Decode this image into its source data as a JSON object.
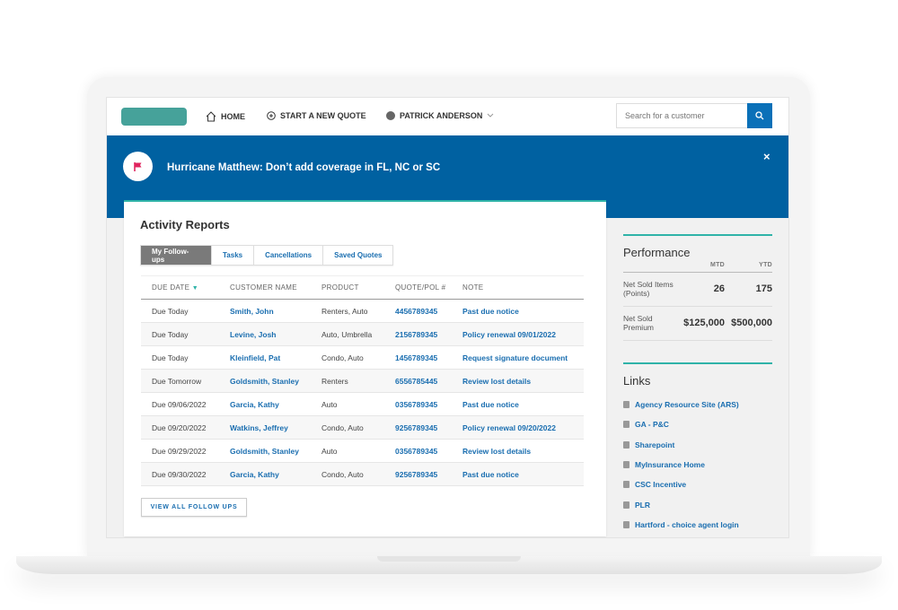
{
  "header": {
    "home": "HOME",
    "new_quote": "START A NEW QUOTE",
    "user": "PATRICK ANDERSON",
    "search_placeholder": "Search for a customer"
  },
  "banner": {
    "text": "Hurricane Matthew: Don’t add coverage in FL, NC or SC",
    "close": "×"
  },
  "activity": {
    "title": "Activity Reports",
    "tabs": [
      "My Follow-ups",
      "Tasks",
      "Cancellations",
      "Saved Quotes"
    ],
    "columns": [
      "DUE DATE",
      "CUSTOMER NAME",
      "PRODUCT",
      "QUOTE/POL #",
      "NOTE"
    ],
    "rows": [
      [
        "Due Today",
        "Smith, John",
        "Renters, Auto",
        "4456789345",
        "Past due notice"
      ],
      [
        "Due Today",
        "Levine, Josh",
        "Auto, Umbrella",
        "2156789345",
        "Policy renewal 09/01/2022"
      ],
      [
        "Due Today",
        "Kleinfield, Pat",
        "Condo, Auto",
        "1456789345",
        "Request signature document"
      ],
      [
        "Due Tomorrow",
        "Goldsmith, Stanley",
        "Renters",
        "6556785445",
        "Review lost details"
      ],
      [
        "Due 09/06/2022",
        "Garcia, Kathy",
        "Auto",
        "0356789345",
        "Past due notice"
      ],
      [
        "Due 09/20/2022",
        "Watkins, Jeffrey",
        "Condo, Auto",
        "9256789345",
        "Policy renewal 09/20/2022"
      ],
      [
        "Due 09/29/2022",
        "Goldsmith, Stanley",
        "Auto",
        "0356789345",
        "Review lost details"
      ],
      [
        "Due 09/30/2022",
        "Garcia, Kathy",
        "Condo, Auto",
        "9256789345",
        "Past due notice"
      ]
    ],
    "view_all": "VIEW ALL FOLLOW UPS"
  },
  "performance": {
    "title": "Performance",
    "cols": [
      "MTD",
      "YTD"
    ],
    "rows": [
      [
        "Net Sold Items (Points)",
        "26",
        "175"
      ],
      [
        "Net Sold Premium",
        "$125,000",
        "$500,000"
      ]
    ]
  },
  "links": {
    "title": "Links",
    "items": [
      "Agency Resource Site (ARS)",
      "GA - P&C",
      "Sharepoint",
      "MyInsurance Home",
      "CSC Incentive",
      "PLR",
      "Hartford - choice agent login"
    ]
  },
  "colors": {
    "banner": "#0061a1",
    "accent": "#2fb3a8",
    "link": "#1a6eb0",
    "logo": "#46a29a",
    "flag": "#e0245e"
  }
}
